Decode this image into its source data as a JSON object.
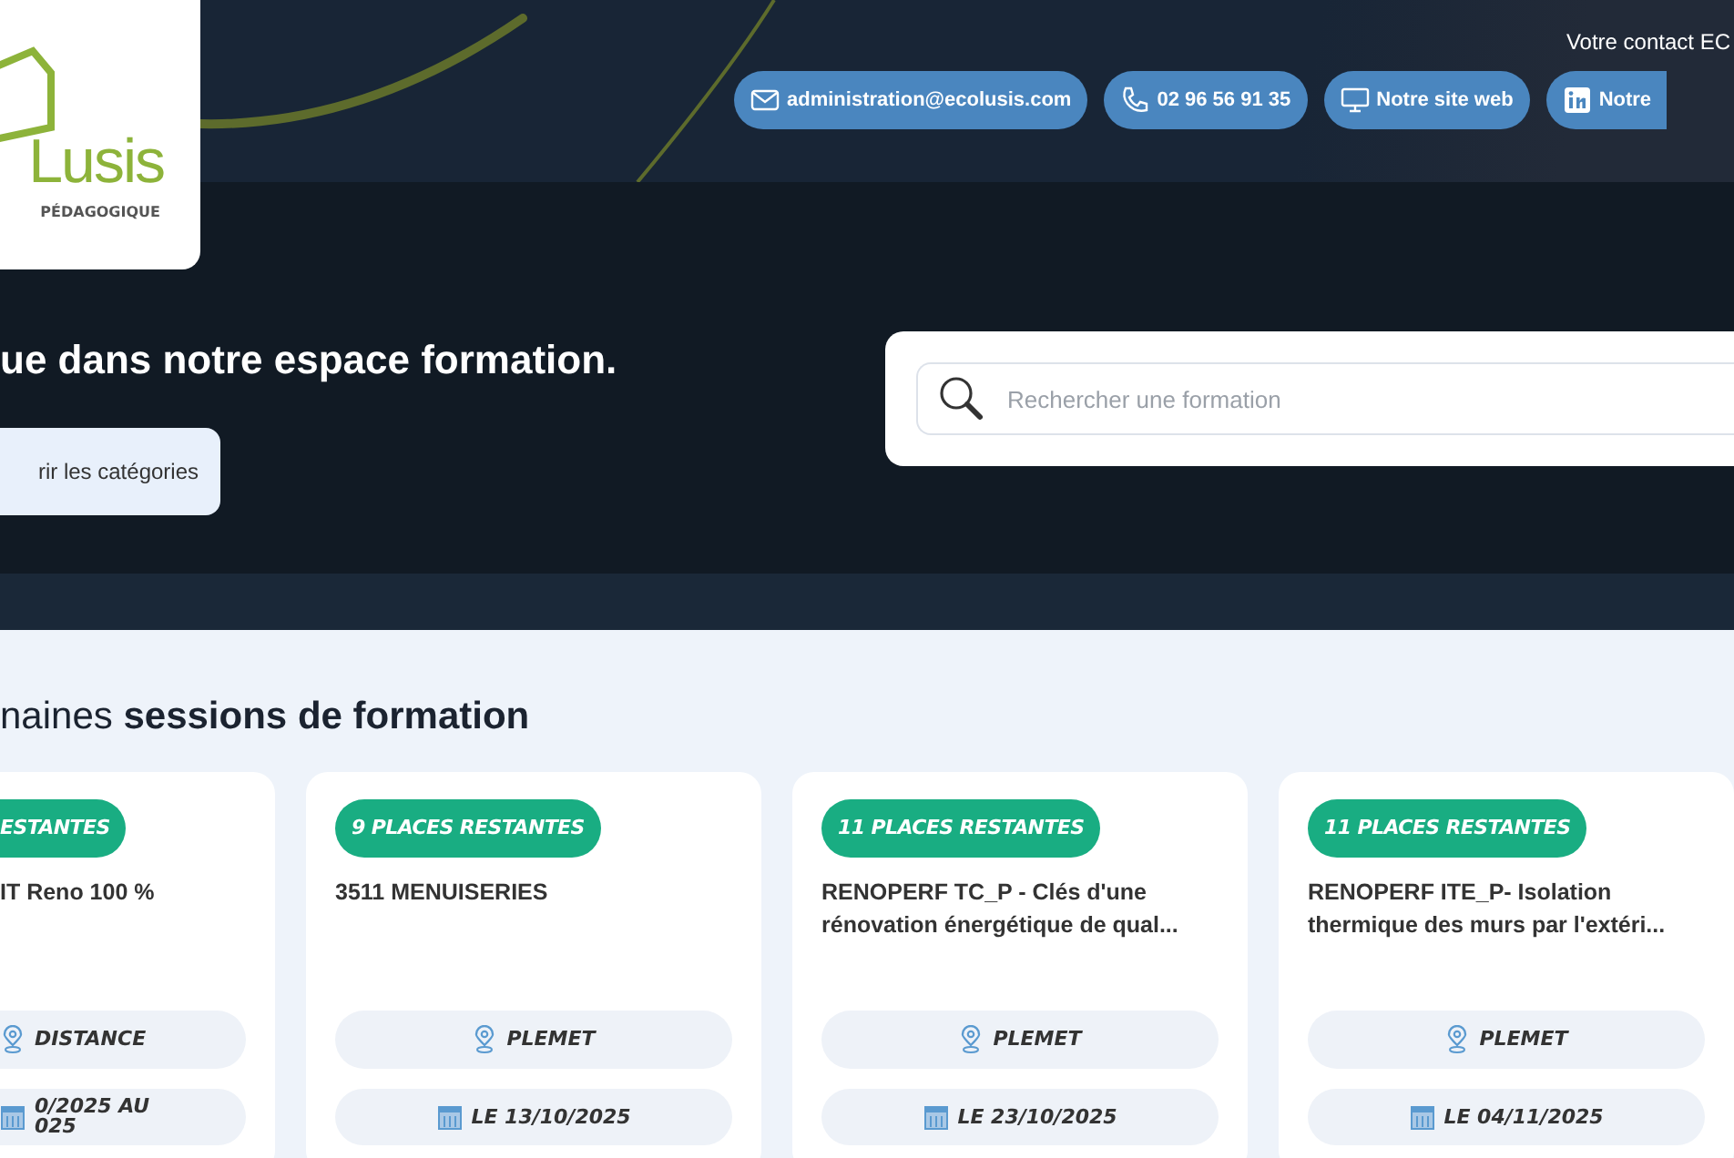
{
  "logo": {
    "wordmark": "Lusis",
    "tagline": "PÉDAGOGIQUE"
  },
  "header": {
    "contact_label": "Votre contact EC",
    "contacts": [
      {
        "kind": "email",
        "label": "administration@ecolusis.com"
      },
      {
        "kind": "phone",
        "label": "02 96 56 91 35"
      },
      {
        "kind": "web",
        "label": "Notre site web"
      },
      {
        "kind": "linkedin",
        "label": "Notre"
      }
    ]
  },
  "hero": {
    "heading": "ue dans notre espace formation.",
    "categories_button": "rir les catégories",
    "search": {
      "placeholder": "Rechercher une formation"
    }
  },
  "sessions": {
    "title": "naines **sessions de formation**",
    "cards": [
      {
        "badge": "ESTANTES",
        "title": "IT Reno 100 %",
        "location": "DISTANCE",
        "date": "0/2025 AU\n025"
      },
      {
        "badge": "9 PLACES RESTANTES",
        "title": "3511 MENUISERIES",
        "location": "PLEMET",
        "date": "LE 13/10/2025"
      },
      {
        "badge": "11 PLACES RESTANTES",
        "title": "RENOPERF TC_P - Clés d'une rénovation énergétique de qual...",
        "location": "PLEMET",
        "date": "LE 23/10/2025"
      },
      {
        "badge": "11 PLACES RESTANTES",
        "title": "RENOPERF ITE_P- Isolation thermique des murs par l'extéri...",
        "location": "PLEMET",
        "date": "LE 04/11/2025"
      }
    ]
  }
}
